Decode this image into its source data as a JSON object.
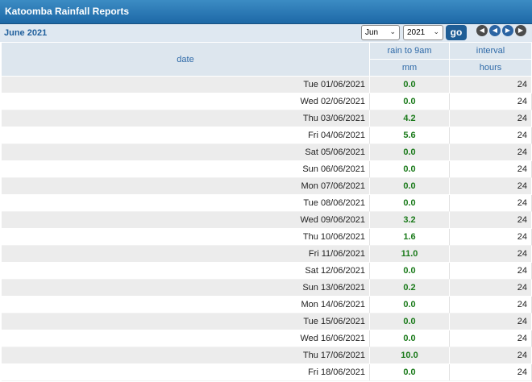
{
  "title": "Katoomba Rainfall Reports",
  "period_label": "June 2021",
  "controls": {
    "month_selected": "Jun",
    "year_selected": "2021",
    "go_label": "go",
    "icons": [
      "first-icon",
      "prev-icon",
      "next-icon",
      "last-icon"
    ]
  },
  "table": {
    "header": {
      "date": "date",
      "rain": "rain to 9am",
      "rain_unit": "mm",
      "interval": "interval",
      "interval_unit": "hours"
    },
    "rows": [
      {
        "date": "Tue 01/06/2021",
        "rain": "0.0",
        "interval": "24"
      },
      {
        "date": "Wed 02/06/2021",
        "rain": "0.0",
        "interval": "24"
      },
      {
        "date": "Thu 03/06/2021",
        "rain": "4.2",
        "interval": "24"
      },
      {
        "date": "Fri 04/06/2021",
        "rain": "5.6",
        "interval": "24"
      },
      {
        "date": "Sat 05/06/2021",
        "rain": "0.0",
        "interval": "24"
      },
      {
        "date": "Sun 06/06/2021",
        "rain": "0.0",
        "interval": "24"
      },
      {
        "date": "Mon 07/06/2021",
        "rain": "0.0",
        "interval": "24"
      },
      {
        "date": "Tue 08/06/2021",
        "rain": "0.0",
        "interval": "24"
      },
      {
        "date": "Wed 09/06/2021",
        "rain": "3.2",
        "interval": "24"
      },
      {
        "date": "Thu 10/06/2021",
        "rain": "1.6",
        "interval": "24"
      },
      {
        "date": "Fri 11/06/2021",
        "rain": "11.0",
        "interval": "24"
      },
      {
        "date": "Sat 12/06/2021",
        "rain": "0.0",
        "interval": "24"
      },
      {
        "date": "Sun 13/06/2021",
        "rain": "0.2",
        "interval": "24"
      },
      {
        "date": "Mon 14/06/2021",
        "rain": "0.0",
        "interval": "24"
      },
      {
        "date": "Tue 15/06/2021",
        "rain": "0.0",
        "interval": "24"
      },
      {
        "date": "Wed 16/06/2021",
        "rain": "0.0",
        "interval": "24"
      },
      {
        "date": "Thu 17/06/2021",
        "rain": "10.0",
        "interval": "24"
      },
      {
        "date": "Fri 18/06/2021",
        "rain": "0.0",
        "interval": "24"
      }
    ]
  },
  "colors": {
    "title_bar": "#2a78b8",
    "header_bg": "#dde6ee",
    "header_text": "#2f6aa8",
    "rain_value": "#1a7a1a",
    "go_button": "#1e5d96"
  }
}
